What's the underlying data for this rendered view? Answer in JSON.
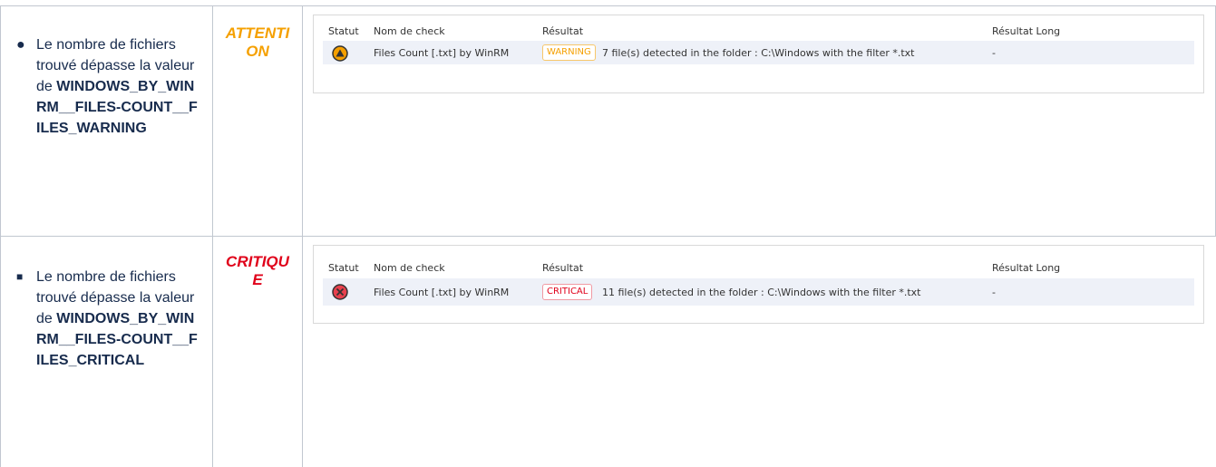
{
  "rows": [
    {
      "description_prefix": "Le nombre de fichiers trouvé dépasse la valeur de ",
      "variable": "WINDOWS_BY_WINRM__FILES-COUNT__FILES_WARNING",
      "level": "ATTENTION",
      "level_color": "#f5a000",
      "panel": {
        "headers": {
          "status": "Statut",
          "check_name": "Nom de check",
          "result": "Résultat",
          "long_result": "Résultat Long"
        },
        "status_icon": "warning-triangle-icon",
        "check_name": "Files Count [.txt] by WinRM",
        "badge": "WARNING",
        "result_text": "7 file(s) detected in the folder : C:\\Windows with the filter *.txt",
        "long_result": "-"
      }
    },
    {
      "description_prefix": "Le nombre de fichiers trouvé dépasse la valeur de ",
      "variable": "WINDOWS_BY_WINRM__FILES-COUNT__FILES_CRITICAL",
      "level": "CRITIQUE",
      "level_color": "#e0001a",
      "panel": {
        "headers": {
          "status": "Statut",
          "check_name": "Nom de check",
          "result": "Résultat",
          "long_result": "Résultat Long"
        },
        "status_icon": "critical-x-icon",
        "check_name": "Files Count [.txt] by WinRM",
        "badge": "CRITICAL",
        "result_text": "11 file(s) detected in the folder : C:\\Windows with the filter *.txt",
        "long_result": "-"
      }
    }
  ]
}
